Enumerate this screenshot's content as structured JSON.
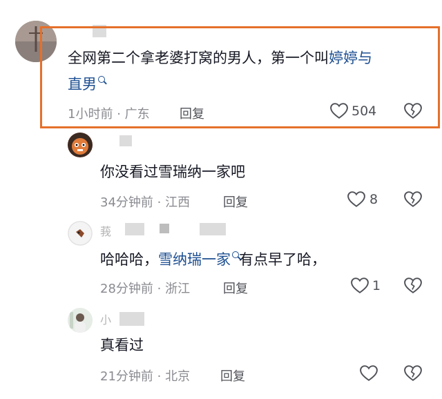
{
  "comments": [
    {
      "text_before": "全网第二个拿老婆打窝的男人，第一个叫",
      "link_line1": "婷婷与",
      "link_line2": "直男",
      "time": "1小时前",
      "location": "广东",
      "reply_label": "回复",
      "likes": "504",
      "name_glyph": ""
    },
    {
      "text": "你没看过雪瑞纳一家吧",
      "time": "34分钟前",
      "location": "江西",
      "reply_label": "回复",
      "likes": "8",
      "name_glyph": ""
    },
    {
      "text_before": "哈哈哈，",
      "link": "雪纳瑞一家",
      "text_after": "有点早了哈，",
      "time": "28分钟前",
      "location": "浙江",
      "reply_label": "回复",
      "likes": "1",
      "name_glyph": "莪"
    },
    {
      "text": "真看过",
      "time": "21分钟前",
      "location": "北京",
      "reply_label": "回复",
      "likes": "",
      "name_glyph": "小"
    }
  ],
  "meta_separator": "·",
  "colors": {
    "highlight": "#e5702a",
    "link": "#1d4f91",
    "meta": "#8a8b91"
  },
  "icons": [
    "heart-outline-icon",
    "broken-heart-icon",
    "search-icon"
  ]
}
